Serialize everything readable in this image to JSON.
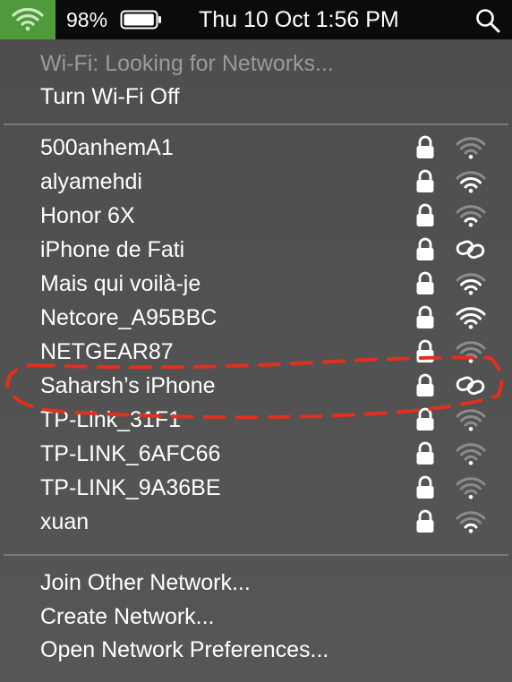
{
  "menubar": {
    "battery_percent": "98%",
    "battery_level": 0.98,
    "clock": "Thu 10 Oct  1:56 PM",
    "wifi_icon": "wifi-icon",
    "search_icon": "spotlight-search-icon"
  },
  "wifi_menu": {
    "status": "Wi-Fi: Looking for Networks...",
    "toggle_label": "Turn Wi-Fi Off",
    "networks": [
      {
        "name": "500anhemA1",
        "locked": true,
        "signal": 1,
        "type": "wifi"
      },
      {
        "name": "alyamehdi",
        "locked": true,
        "signal": 3,
        "type": "wifi"
      },
      {
        "name": "Honor 6X",
        "locked": true,
        "signal": 2,
        "type": "wifi"
      },
      {
        "name": "iPhone de Fati",
        "locked": true,
        "signal": 3,
        "type": "hotspot"
      },
      {
        "name": "Mais qui voilà-je",
        "locked": true,
        "signal": 3,
        "type": "wifi"
      },
      {
        "name": "Netcore_A95BBC",
        "locked": true,
        "signal": 4,
        "type": "wifi"
      },
      {
        "name": "NETGEAR87",
        "locked": true,
        "signal": 1,
        "type": "wifi"
      },
      {
        "name": "Saharsh’s iPhone",
        "locked": true,
        "signal": 3,
        "type": "hotspot"
      },
      {
        "name": "TP-Link_31F1",
        "locked": true,
        "signal": 1,
        "type": "wifi"
      },
      {
        "name": "TP-LINK_6AFC66",
        "locked": true,
        "signal": 1,
        "type": "wifi"
      },
      {
        "name": "TP-LINK_9A36BE",
        "locked": true,
        "signal": 1,
        "type": "wifi"
      },
      {
        "name": "xuan",
        "locked": true,
        "signal": 2,
        "type": "wifi"
      }
    ],
    "join_other": "Join Other Network...",
    "create_network": "Create Network...",
    "open_prefs": "Open Network Preferences..."
  },
  "colors": {
    "menubar_bg": "#0b0b0b",
    "wifi_status_bg": "#4f9a3a",
    "menu_bg": "#515151",
    "disabled_text": "#9a9a9a",
    "annotation": "#e0301e"
  }
}
